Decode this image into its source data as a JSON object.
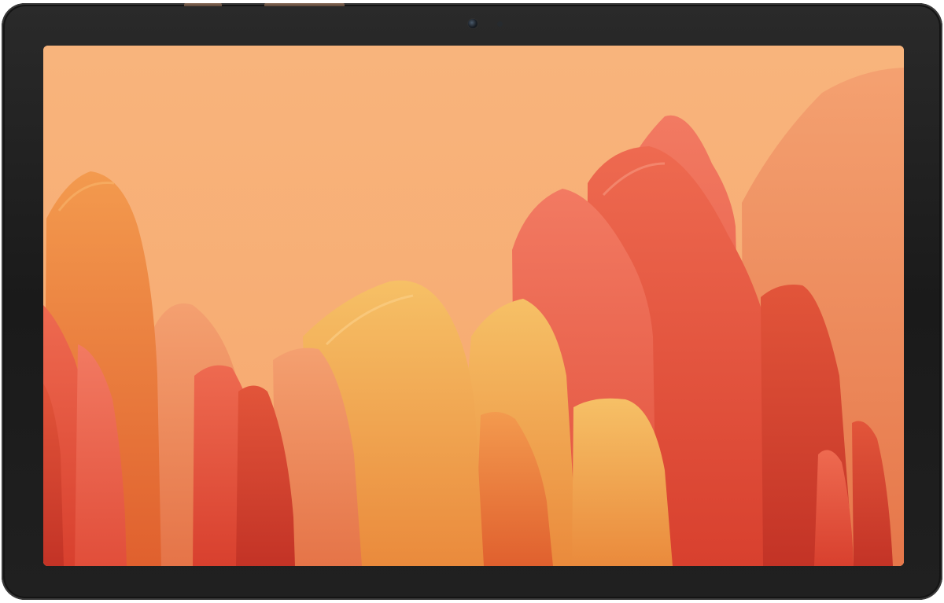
{
  "device": {
    "type": "tablet",
    "orientation": "landscape",
    "bezel_color": "#1e1e1e",
    "button_color": "#7a5e4c"
  },
  "wallpaper": {
    "subject": "abstract-layered-petals",
    "background_color": "#f7b27a",
    "palette": [
      "#f7b27a",
      "#f29a5e",
      "#ee7a52",
      "#e3533c",
      "#d8412f",
      "#f0a24a",
      "#f4bf6a",
      "#c9392a"
    ]
  }
}
